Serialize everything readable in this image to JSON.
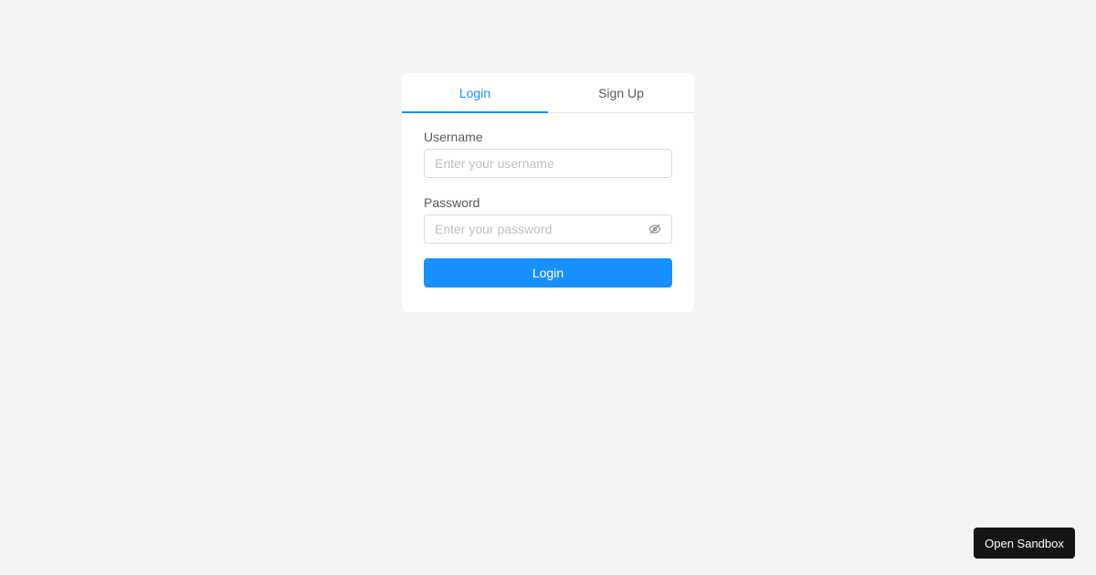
{
  "tabs": [
    {
      "label": "Login",
      "active": true
    },
    {
      "label": "Sign Up",
      "active": false
    }
  ],
  "form": {
    "username": {
      "label": "Username",
      "value": "",
      "placeholder": "Enter your username"
    },
    "password": {
      "label": "Password",
      "value": "",
      "placeholder": "Enter your password",
      "toggle_icon": "eye-invisible-icon"
    },
    "submit_label": "Login"
  },
  "sandbox": {
    "label": "Open Sandbox"
  },
  "colors": {
    "accent": "#1890ff",
    "background": "#f4f4f4",
    "card": "#ffffff",
    "sandbox_button": "#151515"
  }
}
